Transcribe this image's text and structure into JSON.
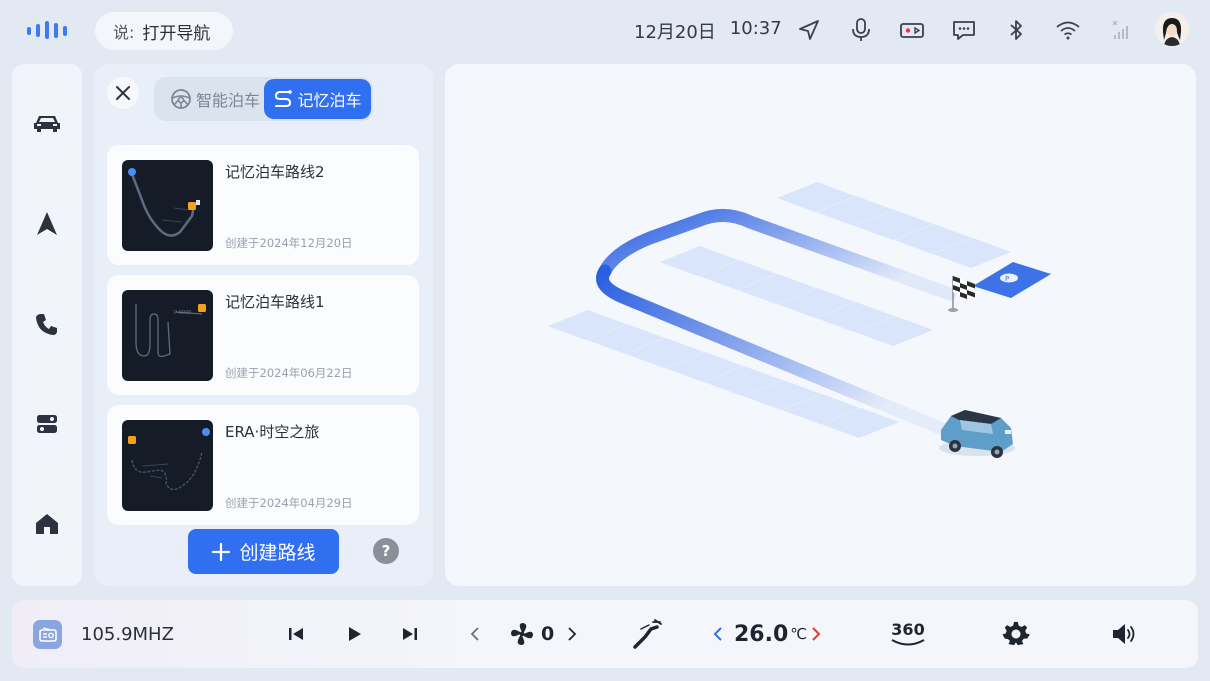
{
  "status_bar": {
    "voice_prefix": "说:",
    "voice_hint": "打开导航",
    "date": "12月20日",
    "time": "10:37"
  },
  "sidebar": {
    "items": [
      {
        "name": "car",
        "icon": "car-icon"
      },
      {
        "name": "navigation",
        "icon": "navigation-arrow-icon"
      },
      {
        "name": "phone",
        "icon": "phone-icon"
      },
      {
        "name": "apps",
        "icon": "toggle-panel-icon"
      },
      {
        "name": "home",
        "icon": "home-icon"
      }
    ]
  },
  "parking_panel": {
    "tabs": [
      {
        "label": "智能泊车",
        "icon": "steering-wheel-icon",
        "active": false
      },
      {
        "label": "记忆泊车",
        "icon": "memory-route-icon",
        "active": true
      }
    ],
    "routes": [
      {
        "name": "记忆泊车路线2",
        "created": "创建于2024年12月20日"
      },
      {
        "name": "记忆泊车路线1",
        "created": "创建于2024年06月22日"
      },
      {
        "name": "ERA·时空之旅",
        "created": "创建于2024年04月29日"
      }
    ],
    "create_label": "创建路线",
    "help_label": "?"
  },
  "bottom_bar": {
    "radio_frequency": "105.9MHZ",
    "fan_level": "0",
    "temperature": "26.0",
    "temperature_unit": "℃",
    "view_360_label": "360"
  },
  "colors": {
    "accent": "#2f6ff0",
    "route_path": "#2a5fe0",
    "background": "#e3e9f3",
    "temp_arrow_left": "#2f6ff0",
    "temp_arrow_right": "#e53935"
  }
}
